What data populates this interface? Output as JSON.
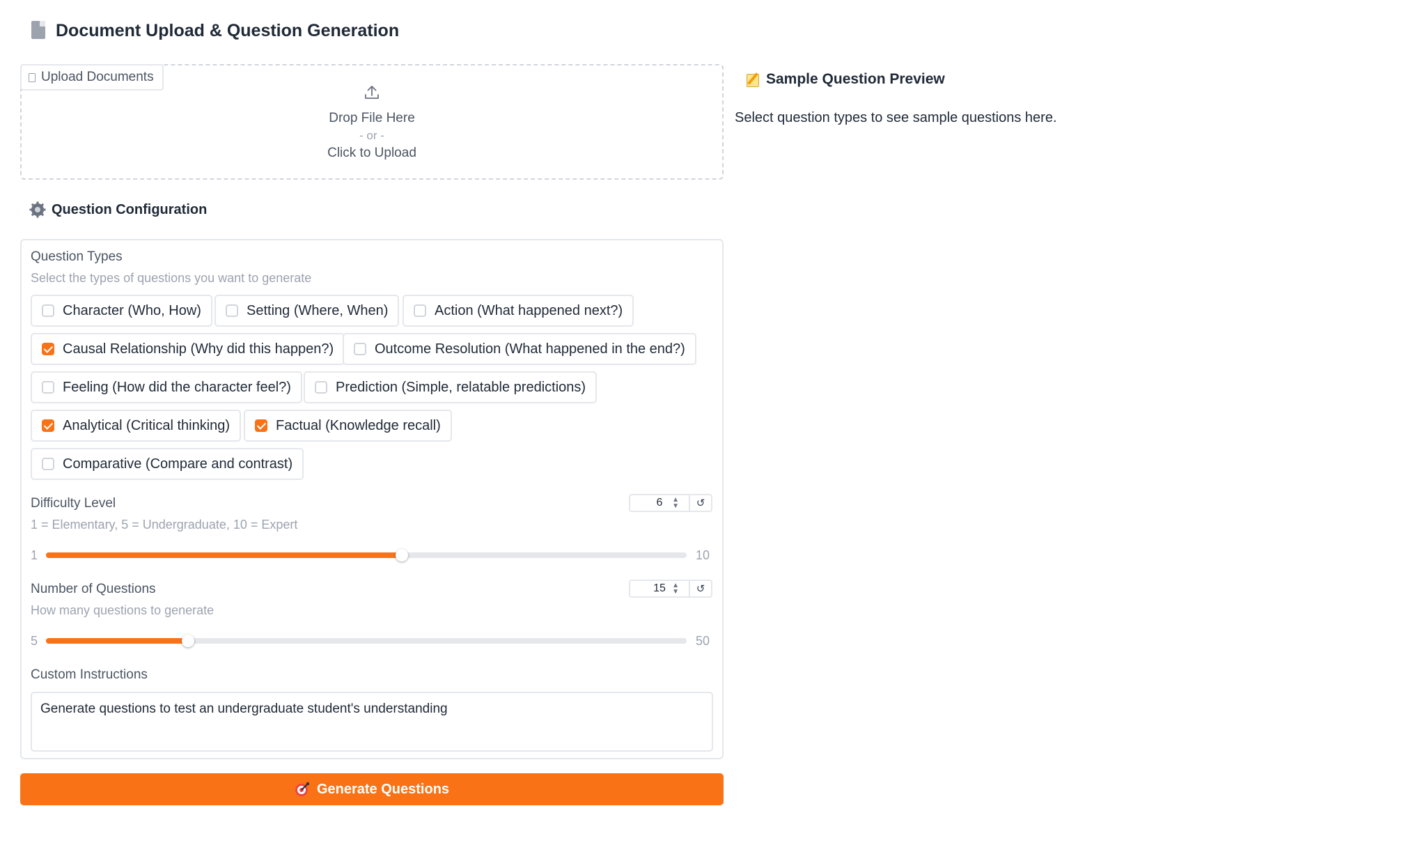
{
  "header": {
    "title": "Document Upload & Question Generation",
    "icon": "document-icon"
  },
  "upload": {
    "tab_label": "Upload Documents",
    "drop_text": "Drop File Here",
    "or_text": "- or -",
    "click_text": "Click to Upload"
  },
  "preview": {
    "title": "Sample Question Preview",
    "message": "Select question types to see sample questions here."
  },
  "config": {
    "title": "Question Configuration",
    "question_types": {
      "label": "Question Types",
      "info": "Select the types of questions you want to generate",
      "options": [
        {
          "label": "Character (Who, How)",
          "checked": false
        },
        {
          "label": "Setting (Where, When)",
          "checked": false
        },
        {
          "label": "Action (What happened next?)",
          "checked": false
        },
        {
          "label": "Causal Relationship (Why did this happen?)",
          "checked": true
        },
        {
          "label": "Outcome Resolution (What happened in the end?)",
          "checked": false
        },
        {
          "label": "Feeling (How did the character feel?)",
          "checked": false
        },
        {
          "label": "Prediction (Simple, relatable predictions)",
          "checked": false
        },
        {
          "label": "Analytical (Critical thinking)",
          "checked": true
        },
        {
          "label": "Factual (Knowledge recall)",
          "checked": true
        },
        {
          "label": "Comparative (Compare and contrast)",
          "checked": false
        }
      ]
    },
    "difficulty": {
      "label": "Difficulty Level",
      "info": "1 = Elementary, 5 = Undergraduate, 10 = Expert",
      "value": "6",
      "min": "1",
      "max": "10"
    },
    "num_questions": {
      "label": "Number of Questions",
      "info": "How many questions to generate",
      "value": "15",
      "min": "5",
      "max": "50"
    },
    "custom_instructions": {
      "label": "Custom Instructions",
      "value": "Generate questions to test an undergraduate student's understanding"
    }
  },
  "generate_button": {
    "label": "Generate Questions",
    "color": "#f97316"
  }
}
